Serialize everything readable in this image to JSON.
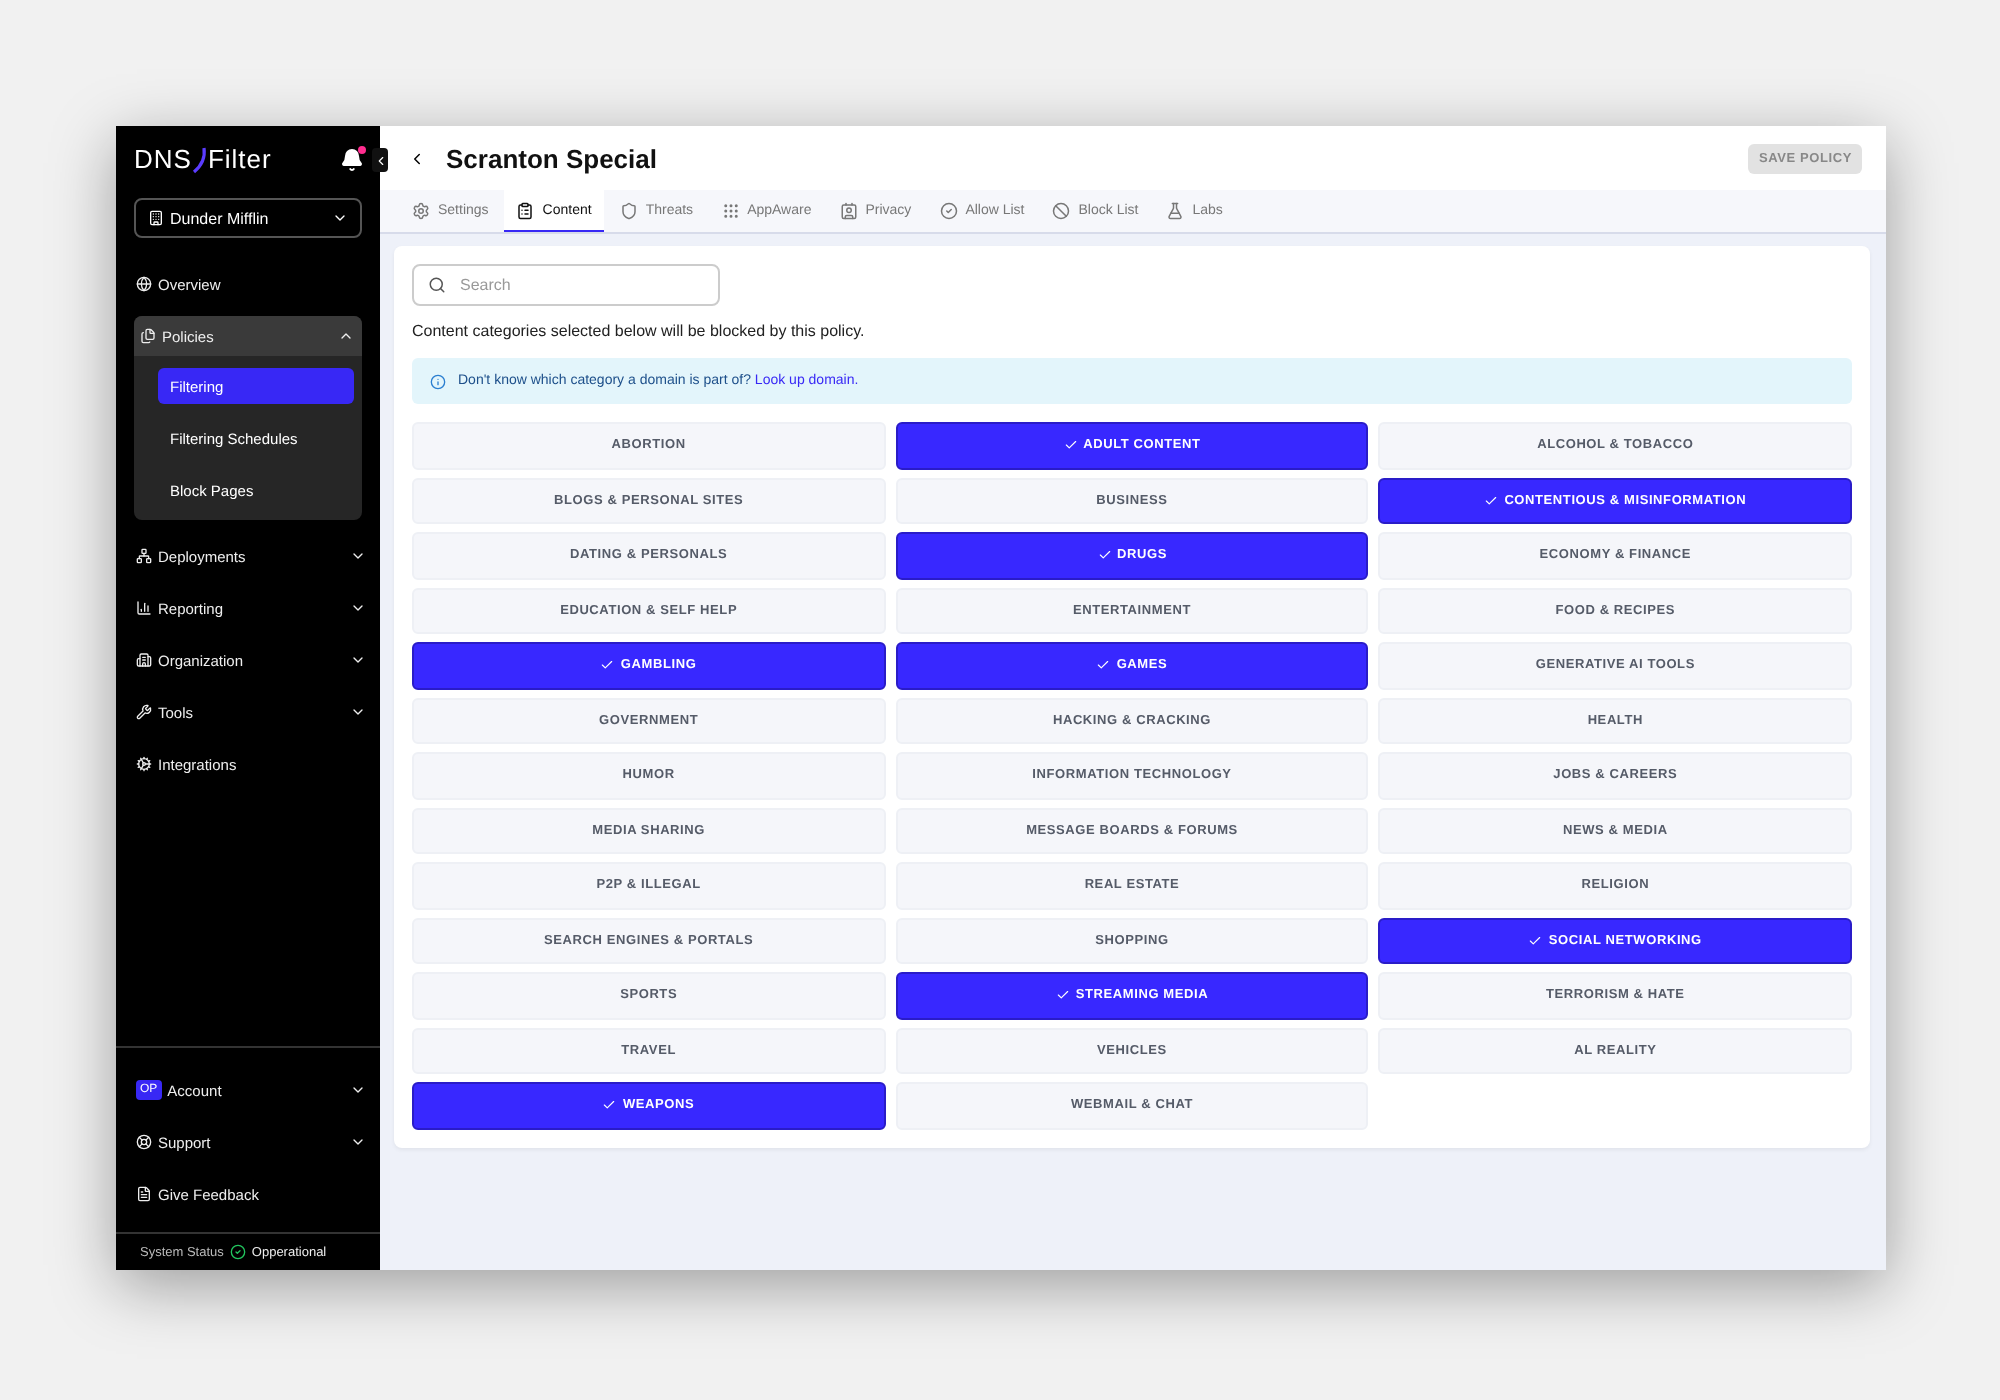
{
  "sidebar": {
    "logo": {
      "left": "DNS",
      "right": "Filter"
    },
    "has_notification": true,
    "org_selector": "Dunder Mifflin",
    "nav": [
      {
        "label": "Overview"
      },
      {
        "label": "Policies",
        "expanded": true,
        "children": [
          {
            "label": "Filtering",
            "selected": true
          },
          {
            "label": "Filtering Schedules",
            "selected": false
          },
          {
            "label": "Block Pages",
            "selected": false
          }
        ]
      },
      {
        "label": "Deployments",
        "expanded": false
      },
      {
        "label": "Reporting",
        "expanded": false
      },
      {
        "label": "Organization",
        "expanded": false
      },
      {
        "label": "Tools",
        "expanded": false
      },
      {
        "label": "Integrations"
      }
    ],
    "bottom_nav": [
      {
        "label": "Account",
        "badge": "OP",
        "expanded": false
      },
      {
        "label": "Support",
        "expanded": false
      },
      {
        "label": "Give Feedback"
      }
    ],
    "status": {
      "label": "System Status",
      "value": "Opperational"
    }
  },
  "header": {
    "title": "Scranton Special",
    "save_button": {
      "label": "SAVE POLICY",
      "disabled": true
    }
  },
  "tabs": [
    {
      "label": "Settings",
      "selected": false
    },
    {
      "label": "Content",
      "selected": true
    },
    {
      "label": "Threats",
      "selected": false
    },
    {
      "label": "AppAware",
      "selected": false
    },
    {
      "label": "Privacy",
      "selected": false
    },
    {
      "label": "Allow List",
      "selected": false
    },
    {
      "label": "Block List",
      "selected": false
    },
    {
      "label": "Labs",
      "selected": false
    }
  ],
  "search": {
    "placeholder": "Search"
  },
  "description": "Content categories selected below will be blocked by this policy.",
  "info": {
    "text": "Don't know which category a domain is part of?",
    "link": "Look up domain."
  },
  "categories": [
    {
      "label": "ABORTION",
      "selected": false
    },
    {
      "label": "ADULT CONTENT",
      "selected": true
    },
    {
      "label": "ALCOHOL & TOBACCO",
      "selected": false
    },
    {
      "label": "BLOGS & PERSONAL SITES",
      "selected": false
    },
    {
      "label": "BUSINESS",
      "selected": false
    },
    {
      "label": "CONTENTIOUS & MISINFORMATION",
      "selected": true
    },
    {
      "label": "DATING & PERSONALS",
      "selected": false
    },
    {
      "label": "DRUGS",
      "selected": true
    },
    {
      "label": "ECONOMY & FINANCE",
      "selected": false
    },
    {
      "label": "EDUCATION & SELF HELP",
      "selected": false
    },
    {
      "label": "ENTERTAINMENT",
      "selected": false
    },
    {
      "label": "FOOD & RECIPES",
      "selected": false
    },
    {
      "label": "GAMBLING",
      "selected": true
    },
    {
      "label": "GAMES",
      "selected": true
    },
    {
      "label": "GENERATIVE AI TOOLS",
      "selected": false
    },
    {
      "label": "GOVERNMENT",
      "selected": false
    },
    {
      "label": "HACKING & CRACKING",
      "selected": false
    },
    {
      "label": "HEALTH",
      "selected": false
    },
    {
      "label": "HUMOR",
      "selected": false
    },
    {
      "label": "INFORMATION TECHNOLOGY",
      "selected": false
    },
    {
      "label": "JOBS & CAREERS",
      "selected": false
    },
    {
      "label": "MEDIA SHARING",
      "selected": false
    },
    {
      "label": "MESSAGE BOARDS & FORUMS",
      "selected": false
    },
    {
      "label": "NEWS & MEDIA",
      "selected": false
    },
    {
      "label": "P2P & ILLEGAL",
      "selected": false
    },
    {
      "label": "REAL ESTATE",
      "selected": false
    },
    {
      "label": "RELIGION",
      "selected": false
    },
    {
      "label": "SEARCH ENGINES & PORTALS",
      "selected": false
    },
    {
      "label": "SHOPPING",
      "selected": false
    },
    {
      "label": "SOCIAL NETWORKING",
      "selected": true
    },
    {
      "label": "SPORTS",
      "selected": false
    },
    {
      "label": "STREAMING MEDIA",
      "selected": true
    },
    {
      "label": "TERRORISM & HATE",
      "selected": false
    },
    {
      "label": "TRAVEL",
      "selected": false
    },
    {
      "label": "VEHICLES",
      "selected": false
    },
    {
      "label": "AL REALITY",
      "selected": false
    },
    {
      "label": "WEAPONS",
      "selected": true
    },
    {
      "label": "WEBMAIL & CHAT",
      "selected": false
    }
  ]
}
